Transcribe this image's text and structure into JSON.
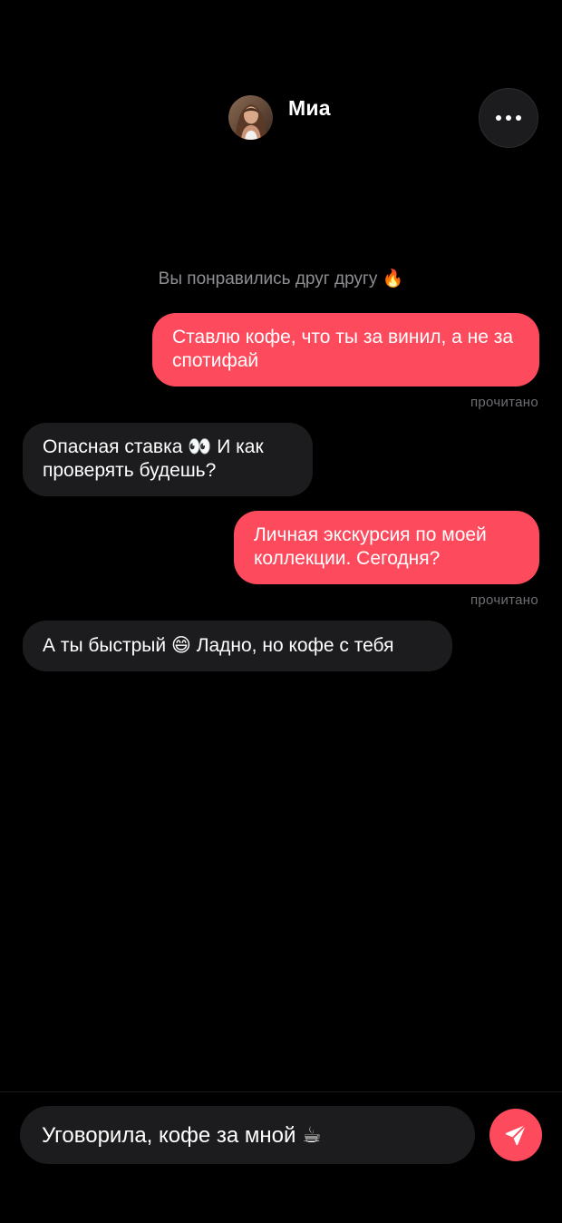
{
  "header": {
    "contact_name": "Миа",
    "more_icon": "more-horizontal-icon",
    "avatar": "profile-photo"
  },
  "chat": {
    "match_notice": "Вы понравились друг другу 🔥",
    "messages": [
      {
        "direction": "outgoing",
        "text": "Ставлю кофе, что ты за винил, а не за спотифай",
        "status": "прочитано"
      },
      {
        "direction": "incoming",
        "text": "Опасная ставка 👀 И как проверять будешь?"
      },
      {
        "direction": "outgoing",
        "text": "Личная экскурсия по моей коллекции. Сегодня?",
        "status": "прочитано"
      },
      {
        "direction": "incoming",
        "text": "А ты быстрый 😄 Ладно, но кофе с тебя"
      }
    ]
  },
  "composer": {
    "value": "Уговорила, кофе за мной ☕",
    "send_icon": "send-icon"
  },
  "colors": {
    "accent": "#fd4a5d",
    "background": "#000000",
    "incoming_bubble": "#1c1c1e",
    "muted_text": "#8e8e93"
  }
}
